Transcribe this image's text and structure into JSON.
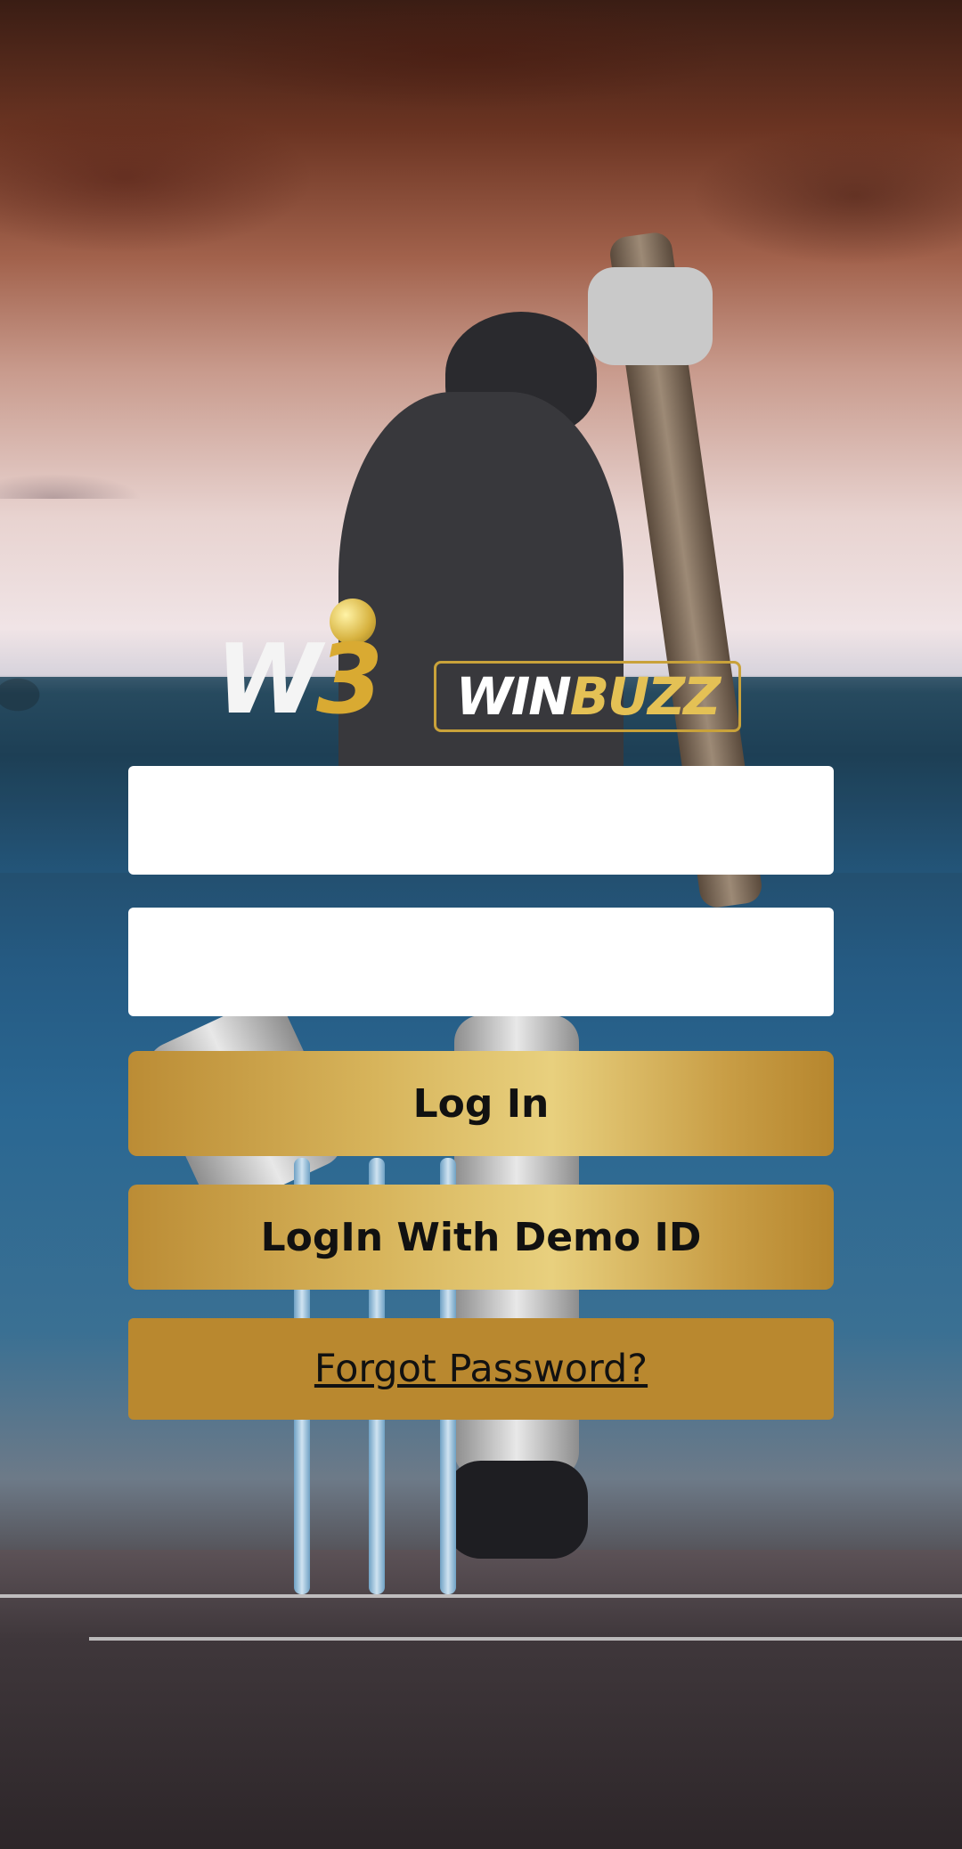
{
  "brand": {
    "logo_mark": "W3",
    "name_part1": "WIN",
    "name_part2": "BUZZ"
  },
  "login_form": {
    "username_value": "",
    "password_value": "",
    "login_label": "Log In",
    "demo_login_label": "LogIn With Demo ID",
    "forgot_password_label": "Forgot Password?"
  },
  "colors": {
    "button_gold": "#d7b45b",
    "forgot_button": "#b9882f",
    "logo_gold": "#d9aa32"
  }
}
